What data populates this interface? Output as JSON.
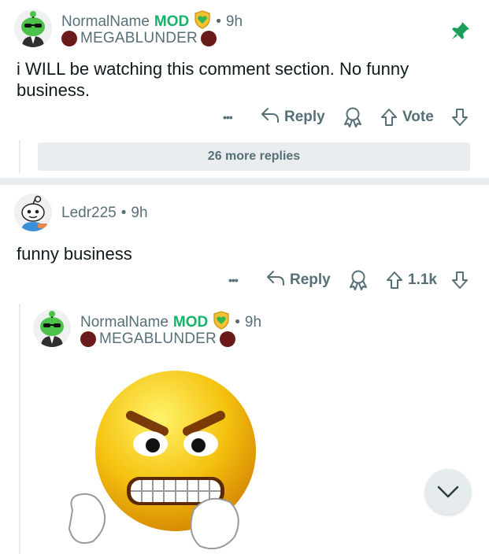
{
  "comment1": {
    "username": "NormalName",
    "mod_label": "MOD",
    "separator": "•",
    "time": "9h",
    "flair": "MEGABLUNDER",
    "body": "i WILL be watching this comment section. No funny business.",
    "actions": {
      "more": "•••",
      "reply": "Reply",
      "vote": "Vote"
    },
    "more_replies": "26 more replies"
  },
  "comment2": {
    "username": "Ledr225",
    "separator": "•",
    "time": "9h",
    "body": "funny business",
    "actions": {
      "more": "•••",
      "reply": "Reply",
      "vote_count": "1.1k"
    }
  },
  "comment3": {
    "username": "NormalName",
    "mod_label": "MOD",
    "separator": "•",
    "time": "9h",
    "flair": "MEGABLUNDER"
  },
  "colors": {
    "mod_green": "#17b169",
    "pin_green": "#1a9e5a",
    "meta_gray": "#576f76",
    "flair_badge": "#6b1a1a"
  },
  "icons": [
    "pin-icon",
    "shield-heart-icon",
    "reply-arrow-icon",
    "award-icon",
    "upvote-icon",
    "downvote-icon",
    "chevron-down-icon"
  ]
}
